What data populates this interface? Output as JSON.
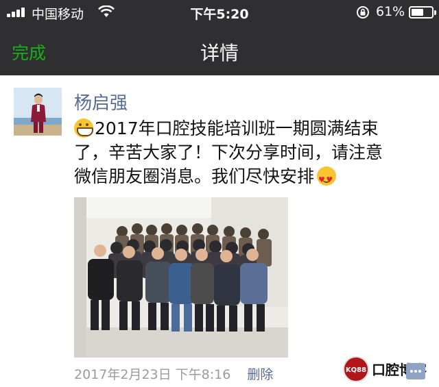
{
  "status_bar": {
    "carrier": "中国移动",
    "time": "下午5:20",
    "battery_percent": "61%",
    "battery_level": 0.61,
    "icons": [
      "signal-icon",
      "wifi-icon",
      "orientation-lock-icon",
      "battery-icon"
    ]
  },
  "nav": {
    "done_label": "完成",
    "title": "详情"
  },
  "post": {
    "username": "杨启强",
    "text_line1": "2017年口腔技能培训班一期圆满结束",
    "text_line2": "了，辛苦大家了！下次分享时间，请注意",
    "text_line3": "微信朋友圈消息。我们尽快安排",
    "leading_emoji": "grin-emoji",
    "trailing_emoji": "heart-eyes-emoji",
    "date": "2017年2月23日 下午8:16",
    "delete_label": "删除"
  },
  "watermark": {
    "logo_text": "KQ88",
    "text": "口腔博客"
  },
  "colors": {
    "nav_bg": "#2f2f31",
    "accent_green": "#1aad19",
    "link_blue": "#576b95",
    "meta_gray": "#9b9b9b"
  }
}
